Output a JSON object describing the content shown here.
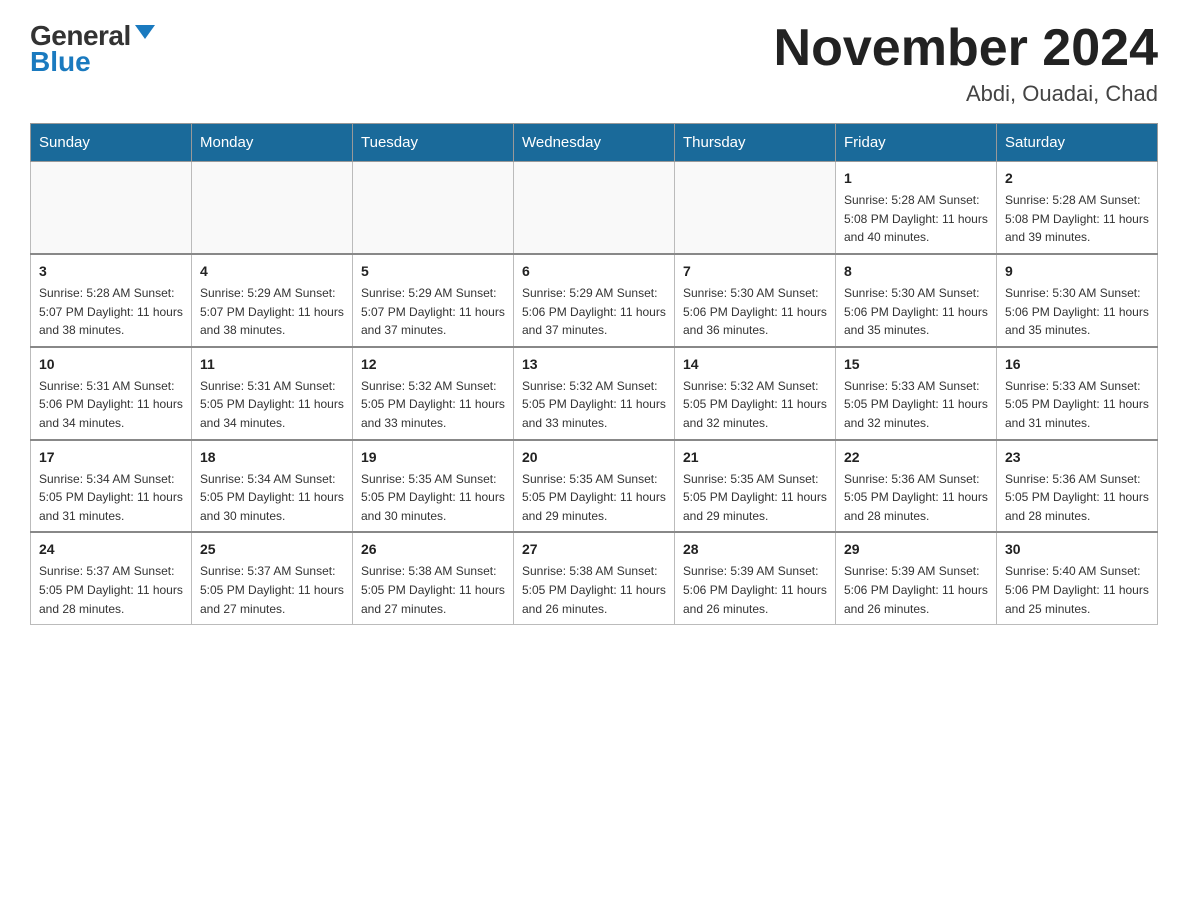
{
  "header": {
    "logo_general": "General",
    "logo_blue": "Blue",
    "month_title": "November 2024",
    "location": "Abdi, Ouadai, Chad"
  },
  "weekdays": [
    "Sunday",
    "Monday",
    "Tuesday",
    "Wednesday",
    "Thursday",
    "Friday",
    "Saturday"
  ],
  "weeks": [
    [
      {
        "day": "",
        "info": ""
      },
      {
        "day": "",
        "info": ""
      },
      {
        "day": "",
        "info": ""
      },
      {
        "day": "",
        "info": ""
      },
      {
        "day": "",
        "info": ""
      },
      {
        "day": "1",
        "info": "Sunrise: 5:28 AM\nSunset: 5:08 PM\nDaylight: 11 hours\nand 40 minutes."
      },
      {
        "day": "2",
        "info": "Sunrise: 5:28 AM\nSunset: 5:08 PM\nDaylight: 11 hours\nand 39 minutes."
      }
    ],
    [
      {
        "day": "3",
        "info": "Sunrise: 5:28 AM\nSunset: 5:07 PM\nDaylight: 11 hours\nand 38 minutes."
      },
      {
        "day": "4",
        "info": "Sunrise: 5:29 AM\nSunset: 5:07 PM\nDaylight: 11 hours\nand 38 minutes."
      },
      {
        "day": "5",
        "info": "Sunrise: 5:29 AM\nSunset: 5:07 PM\nDaylight: 11 hours\nand 37 minutes."
      },
      {
        "day": "6",
        "info": "Sunrise: 5:29 AM\nSunset: 5:06 PM\nDaylight: 11 hours\nand 37 minutes."
      },
      {
        "day": "7",
        "info": "Sunrise: 5:30 AM\nSunset: 5:06 PM\nDaylight: 11 hours\nand 36 minutes."
      },
      {
        "day": "8",
        "info": "Sunrise: 5:30 AM\nSunset: 5:06 PM\nDaylight: 11 hours\nand 35 minutes."
      },
      {
        "day": "9",
        "info": "Sunrise: 5:30 AM\nSunset: 5:06 PM\nDaylight: 11 hours\nand 35 minutes."
      }
    ],
    [
      {
        "day": "10",
        "info": "Sunrise: 5:31 AM\nSunset: 5:06 PM\nDaylight: 11 hours\nand 34 minutes."
      },
      {
        "day": "11",
        "info": "Sunrise: 5:31 AM\nSunset: 5:05 PM\nDaylight: 11 hours\nand 34 minutes."
      },
      {
        "day": "12",
        "info": "Sunrise: 5:32 AM\nSunset: 5:05 PM\nDaylight: 11 hours\nand 33 minutes."
      },
      {
        "day": "13",
        "info": "Sunrise: 5:32 AM\nSunset: 5:05 PM\nDaylight: 11 hours\nand 33 minutes."
      },
      {
        "day": "14",
        "info": "Sunrise: 5:32 AM\nSunset: 5:05 PM\nDaylight: 11 hours\nand 32 minutes."
      },
      {
        "day": "15",
        "info": "Sunrise: 5:33 AM\nSunset: 5:05 PM\nDaylight: 11 hours\nand 32 minutes."
      },
      {
        "day": "16",
        "info": "Sunrise: 5:33 AM\nSunset: 5:05 PM\nDaylight: 11 hours\nand 31 minutes."
      }
    ],
    [
      {
        "day": "17",
        "info": "Sunrise: 5:34 AM\nSunset: 5:05 PM\nDaylight: 11 hours\nand 31 minutes."
      },
      {
        "day": "18",
        "info": "Sunrise: 5:34 AM\nSunset: 5:05 PM\nDaylight: 11 hours\nand 30 minutes."
      },
      {
        "day": "19",
        "info": "Sunrise: 5:35 AM\nSunset: 5:05 PM\nDaylight: 11 hours\nand 30 minutes."
      },
      {
        "day": "20",
        "info": "Sunrise: 5:35 AM\nSunset: 5:05 PM\nDaylight: 11 hours\nand 29 minutes."
      },
      {
        "day": "21",
        "info": "Sunrise: 5:35 AM\nSunset: 5:05 PM\nDaylight: 11 hours\nand 29 minutes."
      },
      {
        "day": "22",
        "info": "Sunrise: 5:36 AM\nSunset: 5:05 PM\nDaylight: 11 hours\nand 28 minutes."
      },
      {
        "day": "23",
        "info": "Sunrise: 5:36 AM\nSunset: 5:05 PM\nDaylight: 11 hours\nand 28 minutes."
      }
    ],
    [
      {
        "day": "24",
        "info": "Sunrise: 5:37 AM\nSunset: 5:05 PM\nDaylight: 11 hours\nand 28 minutes."
      },
      {
        "day": "25",
        "info": "Sunrise: 5:37 AM\nSunset: 5:05 PM\nDaylight: 11 hours\nand 27 minutes."
      },
      {
        "day": "26",
        "info": "Sunrise: 5:38 AM\nSunset: 5:05 PM\nDaylight: 11 hours\nand 27 minutes."
      },
      {
        "day": "27",
        "info": "Sunrise: 5:38 AM\nSunset: 5:05 PM\nDaylight: 11 hours\nand 26 minutes."
      },
      {
        "day": "28",
        "info": "Sunrise: 5:39 AM\nSunset: 5:06 PM\nDaylight: 11 hours\nand 26 minutes."
      },
      {
        "day": "29",
        "info": "Sunrise: 5:39 AM\nSunset: 5:06 PM\nDaylight: 11 hours\nand 26 minutes."
      },
      {
        "day": "30",
        "info": "Sunrise: 5:40 AM\nSunset: 5:06 PM\nDaylight: 11 hours\nand 25 minutes."
      }
    ]
  ]
}
